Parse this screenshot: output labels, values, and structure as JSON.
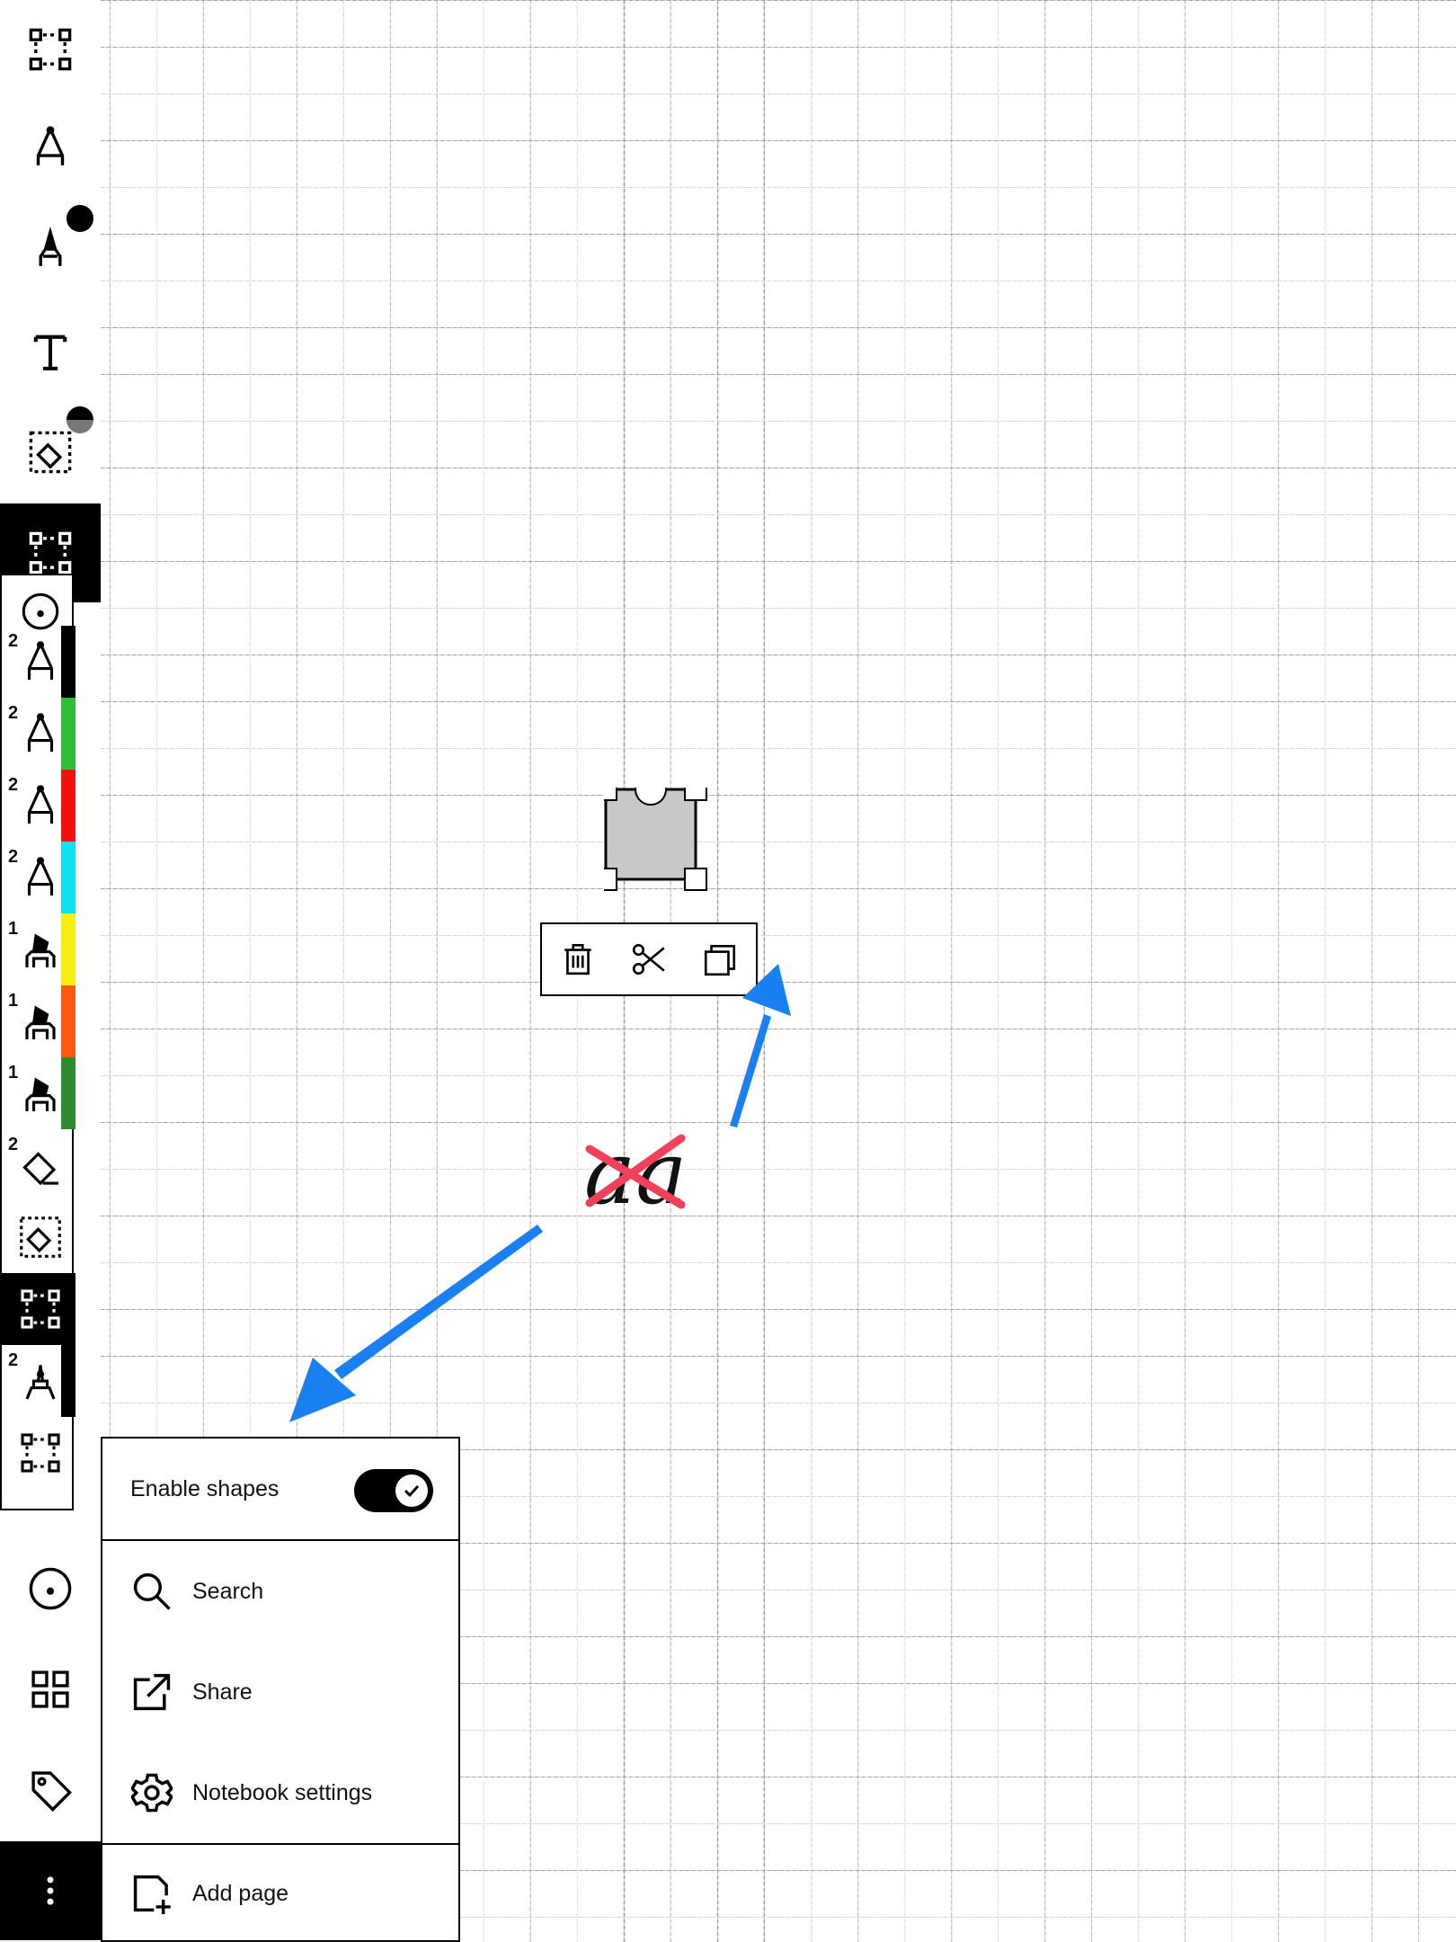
{
  "menu": {
    "enable_shapes_label": "Enable shapes",
    "enable_shapes_on": true,
    "items": [
      {
        "label": "Search",
        "icon": "search-icon"
      },
      {
        "label": "Share",
        "icon": "share-icon"
      },
      {
        "label": "Notebook settings",
        "icon": "gear-icon"
      },
      {
        "label": "Add page",
        "icon": "add-page-icon"
      }
    ]
  },
  "presets": [
    {
      "num": "",
      "icon": "lasso-icon",
      "color": ""
    },
    {
      "num": "2",
      "icon": "fountain-pen-icon",
      "color": "#000000"
    },
    {
      "num": "2",
      "icon": "fountain-pen-icon",
      "color": "#2fbf3a"
    },
    {
      "num": "2",
      "icon": "fountain-pen-icon",
      "color": "#f21111"
    },
    {
      "num": "2",
      "icon": "fountain-pen-icon",
      "color": "#11e0f0"
    },
    {
      "num": "1",
      "icon": "highlighter-icon",
      "color": "#f5f010"
    },
    {
      "num": "1",
      "icon": "highlighter-icon",
      "color": "#ff5a14"
    },
    {
      "num": "1",
      "icon": "highlighter-icon",
      "color": "#2e8b2e"
    },
    {
      "num": "2",
      "icon": "eraser-icon",
      "color": ""
    },
    {
      "num": "",
      "icon": "selection-eraser-icon",
      "color": ""
    },
    {
      "num": "",
      "icon": "selection-icon",
      "color": ""
    },
    {
      "num": "2",
      "icon": "marker-icon",
      "color": "#000000"
    },
    {
      "num": "",
      "icon": "selection-icon",
      "color": ""
    }
  ],
  "colors": {
    "arrow": "#1a7ff0",
    "cross": "#f0405a",
    "selected_shape": "#c8c8c8"
  },
  "handwriting_text": "aa"
}
